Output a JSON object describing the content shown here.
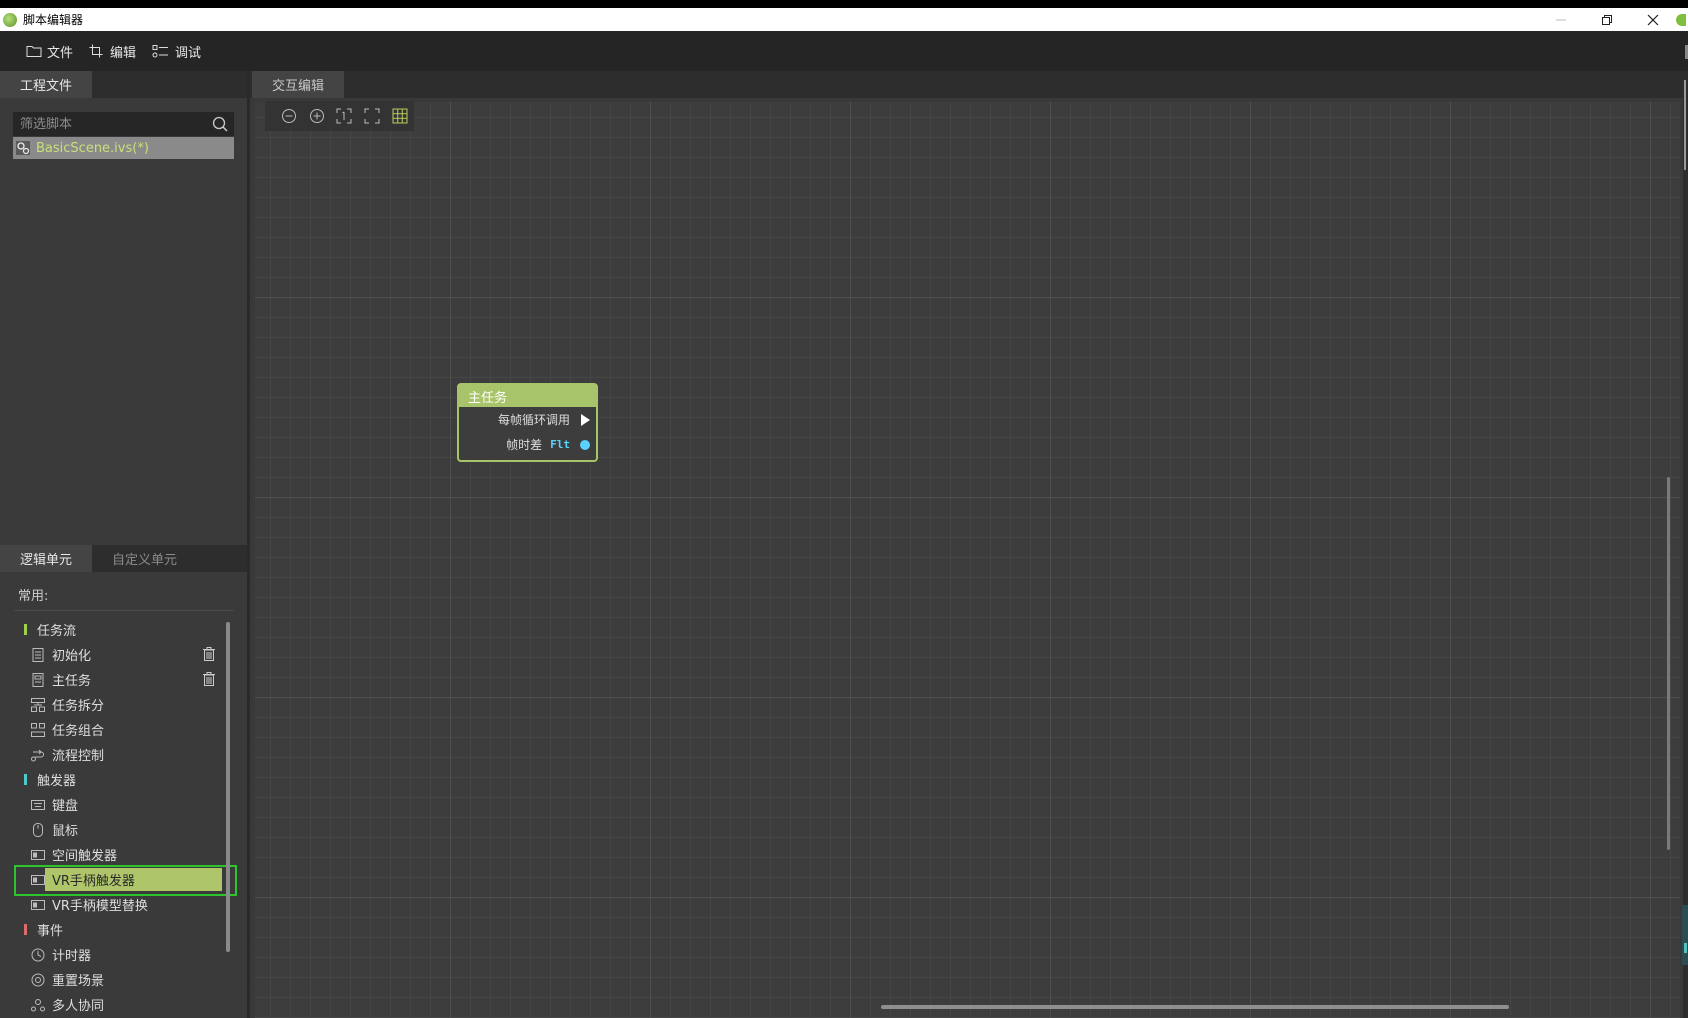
{
  "window": {
    "title": "脚本编辑器",
    "controls": [
      "minimize",
      "restore",
      "close"
    ]
  },
  "menubar": {
    "items": [
      {
        "label": "文件",
        "icon": "folder-icon"
      },
      {
        "label": "编辑",
        "icon": "crop-icon"
      },
      {
        "label": "调试",
        "icon": "debug-icon"
      }
    ]
  },
  "project_panel": {
    "tab_label": "工程文件",
    "search": {
      "placeholder": "筛选脚本",
      "value": ""
    },
    "files": [
      {
        "name": "BasicScene.ivs(*)",
        "selected": true
      }
    ]
  },
  "units_panel": {
    "tabs": [
      "逻辑单元",
      "自定义单元"
    ],
    "active_tab": 0,
    "section_label": "常用:",
    "tree": [
      {
        "type": "category",
        "label": "任务流",
        "color": "#9ed14a"
      },
      {
        "type": "item",
        "label": "初始化",
        "icon": "document-icon",
        "deletable": true
      },
      {
        "type": "item",
        "label": "主任务",
        "icon": "document-icon",
        "deletable": true
      },
      {
        "type": "item",
        "label": "任务拆分",
        "icon": "split-icon"
      },
      {
        "type": "item",
        "label": "任务组合",
        "icon": "combine-icon"
      },
      {
        "type": "item",
        "label": "流程控制",
        "icon": "flow-icon"
      },
      {
        "type": "category",
        "label": "触发器",
        "color": "#4ec9c9"
      },
      {
        "type": "item",
        "label": "键盘",
        "icon": "keyboard-icon"
      },
      {
        "type": "item",
        "label": "鼠标",
        "icon": "mouse-icon"
      },
      {
        "type": "item",
        "label": "空间触发器",
        "icon": "trigger-icon"
      },
      {
        "type": "item",
        "label": "VR手柄触发器",
        "icon": "trigger-icon",
        "selected": true
      },
      {
        "type": "item",
        "label": "VR手柄模型替换",
        "icon": "trigger-icon"
      },
      {
        "type": "category",
        "label": "事件",
        "color": "#e06a6a"
      },
      {
        "type": "item",
        "label": "计时器",
        "icon": "clock-icon"
      },
      {
        "type": "item",
        "label": "重置场景",
        "icon": "reset-icon"
      },
      {
        "type": "item",
        "label": "多人协同",
        "icon": "people-icon"
      }
    ]
  },
  "editor": {
    "tab_label": "交互编辑",
    "toolbar": [
      "zoom-out-icon",
      "zoom-in-icon",
      "fit-icon",
      "fullscreen-icon",
      "grid-icon"
    ],
    "node": {
      "title": "主任务",
      "header_color": "#a8c46a",
      "rows": [
        {
          "label": "每帧循环调用",
          "pin": "exec"
        },
        {
          "label": "帧时差",
          "type_tag": "Flt",
          "pin": "data"
        }
      ]
    }
  }
}
